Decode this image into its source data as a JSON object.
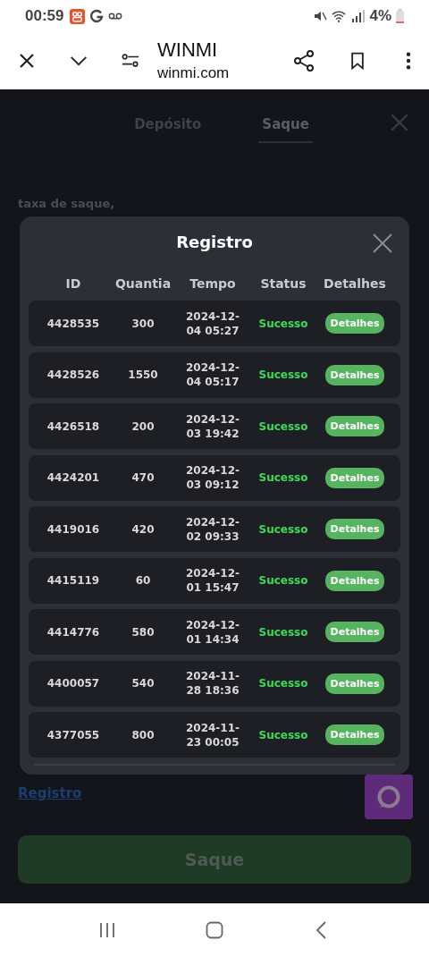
{
  "status_bar": {
    "time": "00:59",
    "battery": "4%"
  },
  "browser": {
    "title": "WINMI",
    "url": "winmi.com"
  },
  "tabs": [
    {
      "label": "Depósito",
      "selected": false
    },
    {
      "label": "Saque",
      "selected": true
    }
  ],
  "background_text": "taxa de saque,",
  "modal": {
    "title": "Registro",
    "columns": [
      "ID",
      "Quantia",
      "Tempo",
      "Status",
      "Detalhes"
    ],
    "rows": [
      {
        "id": "4428535",
        "amount": "300",
        "time": "2024-12-04 05:27",
        "status": "Sucesso",
        "action": "Detalhes"
      },
      {
        "id": "4428526",
        "amount": "1550",
        "time": "2024-12-04 05:17",
        "status": "Sucesso",
        "action": "Detalhes"
      },
      {
        "id": "4426518",
        "amount": "200",
        "time": "2024-12-03 19:42",
        "status": "Sucesso",
        "action": "Detalhes"
      },
      {
        "id": "4424201",
        "amount": "470",
        "time": "2024-12-03 09:12",
        "status": "Sucesso",
        "action": "Detalhes"
      },
      {
        "id": "4419016",
        "amount": "420",
        "time": "2024-12-02 09:33",
        "status": "Sucesso",
        "action": "Detalhes"
      },
      {
        "id": "4415119",
        "amount": "60",
        "time": "2024-12-01 15:47",
        "status": "Sucesso",
        "action": "Detalhes"
      },
      {
        "id": "4414776",
        "amount": "580",
        "time": "2024-12-01 14:34",
        "status": "Sucesso",
        "action": "Detalhes"
      },
      {
        "id": "4400057",
        "amount": "540",
        "time": "2024-11-28 18:36",
        "status": "Sucesso",
        "action": "Detalhes"
      },
      {
        "id": "4377055",
        "amount": "800",
        "time": "2024-11-23 00:05",
        "status": "Sucesso",
        "action": "Detalhes"
      }
    ]
  },
  "record_link": "Registro",
  "submit_button": "Saque"
}
